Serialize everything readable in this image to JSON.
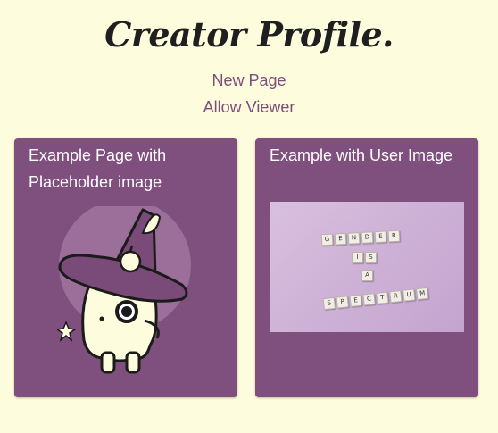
{
  "header": {
    "title": "Creator Profile."
  },
  "nav": {
    "new_page": "New Page",
    "allow_viewer": "Allow Viewer"
  },
  "cards": [
    {
      "title": "Example Page with Placeholder image",
      "image": "witch-hat-creature-illustration"
    },
    {
      "title": "Example with User Image",
      "image": "letter-tiles-photo"
    }
  ],
  "photo_text": {
    "line1": "GENDER",
    "line2": "IS",
    "line3": "A",
    "line4": "SPECTRUM"
  },
  "colors": {
    "background": "#fdfcdc",
    "card": "#7f4f7e",
    "link": "#7b4d7b",
    "title": "#1f1f1f"
  }
}
